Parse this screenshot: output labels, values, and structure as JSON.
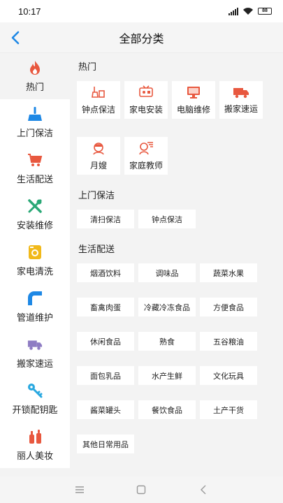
{
  "status_bar": {
    "time": "10:17",
    "battery": "88"
  },
  "header": {
    "title": "全部分类"
  },
  "sidebar": {
    "items": [
      {
        "label": "热门",
        "icon": "fire-icon"
      },
      {
        "label": "上门保洁",
        "icon": "mop-icon"
      },
      {
        "label": "生活配送",
        "icon": "cart-icon"
      },
      {
        "label": "安装维修",
        "icon": "tools-icon"
      },
      {
        "label": "家电清洗",
        "icon": "washer-icon"
      },
      {
        "label": "管道维护",
        "icon": "pipe-icon"
      },
      {
        "label": "搬家速运",
        "icon": "truck-icon"
      },
      {
        "label": "开锁配钥匙",
        "icon": "key-icon"
      },
      {
        "label": "丽人美妆",
        "icon": "cosmetics-icon"
      }
    ]
  },
  "sections": {
    "hot": {
      "title": "热门",
      "items": [
        {
          "label": "钟点保洁",
          "icon": "cleaning-icon"
        },
        {
          "label": "家电安装",
          "icon": "appliance-icon"
        },
        {
          "label": "电脑维修",
          "icon": "computer-icon"
        },
        {
          "label": "搬家速运",
          "icon": "moving-truck-icon"
        },
        {
          "label": "月嫂",
          "icon": "nanny-icon"
        },
        {
          "label": "家庭教师",
          "icon": "tutor-icon"
        }
      ]
    },
    "cleaning": {
      "title": "上门保洁",
      "items": [
        "清扫保洁",
        "钟点保洁"
      ]
    },
    "delivery": {
      "title": "生活配送",
      "items": [
        "烟酒饮料",
        "调味品",
        "蔬菜水果",
        "畜禽肉蛋",
        "冷藏冷冻食品",
        "方便食品",
        "休闲食品",
        "熟食",
        "五谷粮油",
        "面包乳品",
        "水产生鲜",
        "文化玩具",
        "酱菜罐头",
        "餐饮食品",
        "土产干货",
        "其他日常用品"
      ]
    }
  },
  "colors": {
    "accent": "#1e88e5",
    "hot_red": "#e8583f"
  }
}
